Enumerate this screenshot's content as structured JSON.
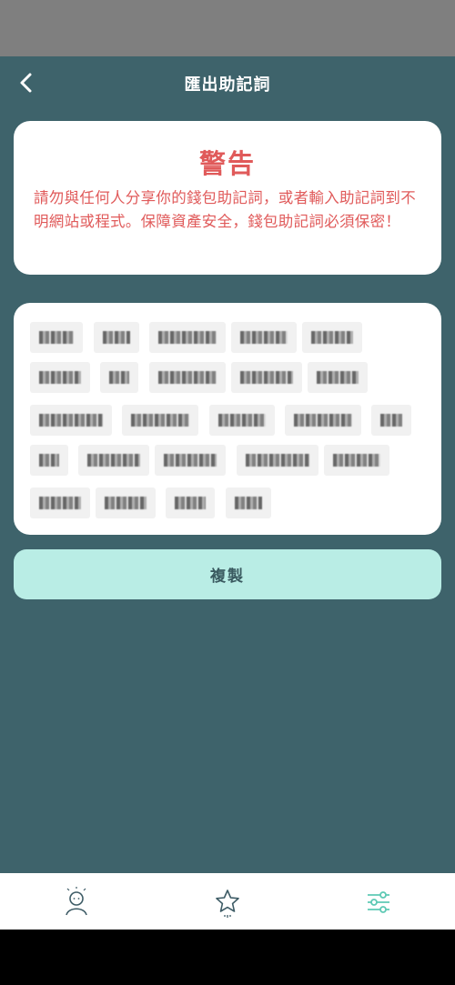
{
  "header": {
    "title": "匯出助記詞",
    "back_icon": "chevron-left-icon"
  },
  "warning": {
    "title": "警告",
    "message": "請勿與任何人分享你的錢包助記詞，或者輸入助記詞到不明網站或程式。保障資產安全，錢包助記詞必須保密！",
    "color": "#e05a5a"
  },
  "mnemonic": {
    "obscured": true,
    "word_count": 24
  },
  "actions": {
    "copy_label": "複製",
    "copy_bg": "#b9ede5"
  },
  "tabbar": {
    "items": [
      {
        "icon": "user-icon",
        "active": false
      },
      {
        "icon": "star-icon",
        "active": false
      },
      {
        "icon": "settings-sliders-icon",
        "active": true
      }
    ],
    "active_color": "#5ec9b4"
  },
  "colors": {
    "background": "#3e636b"
  }
}
